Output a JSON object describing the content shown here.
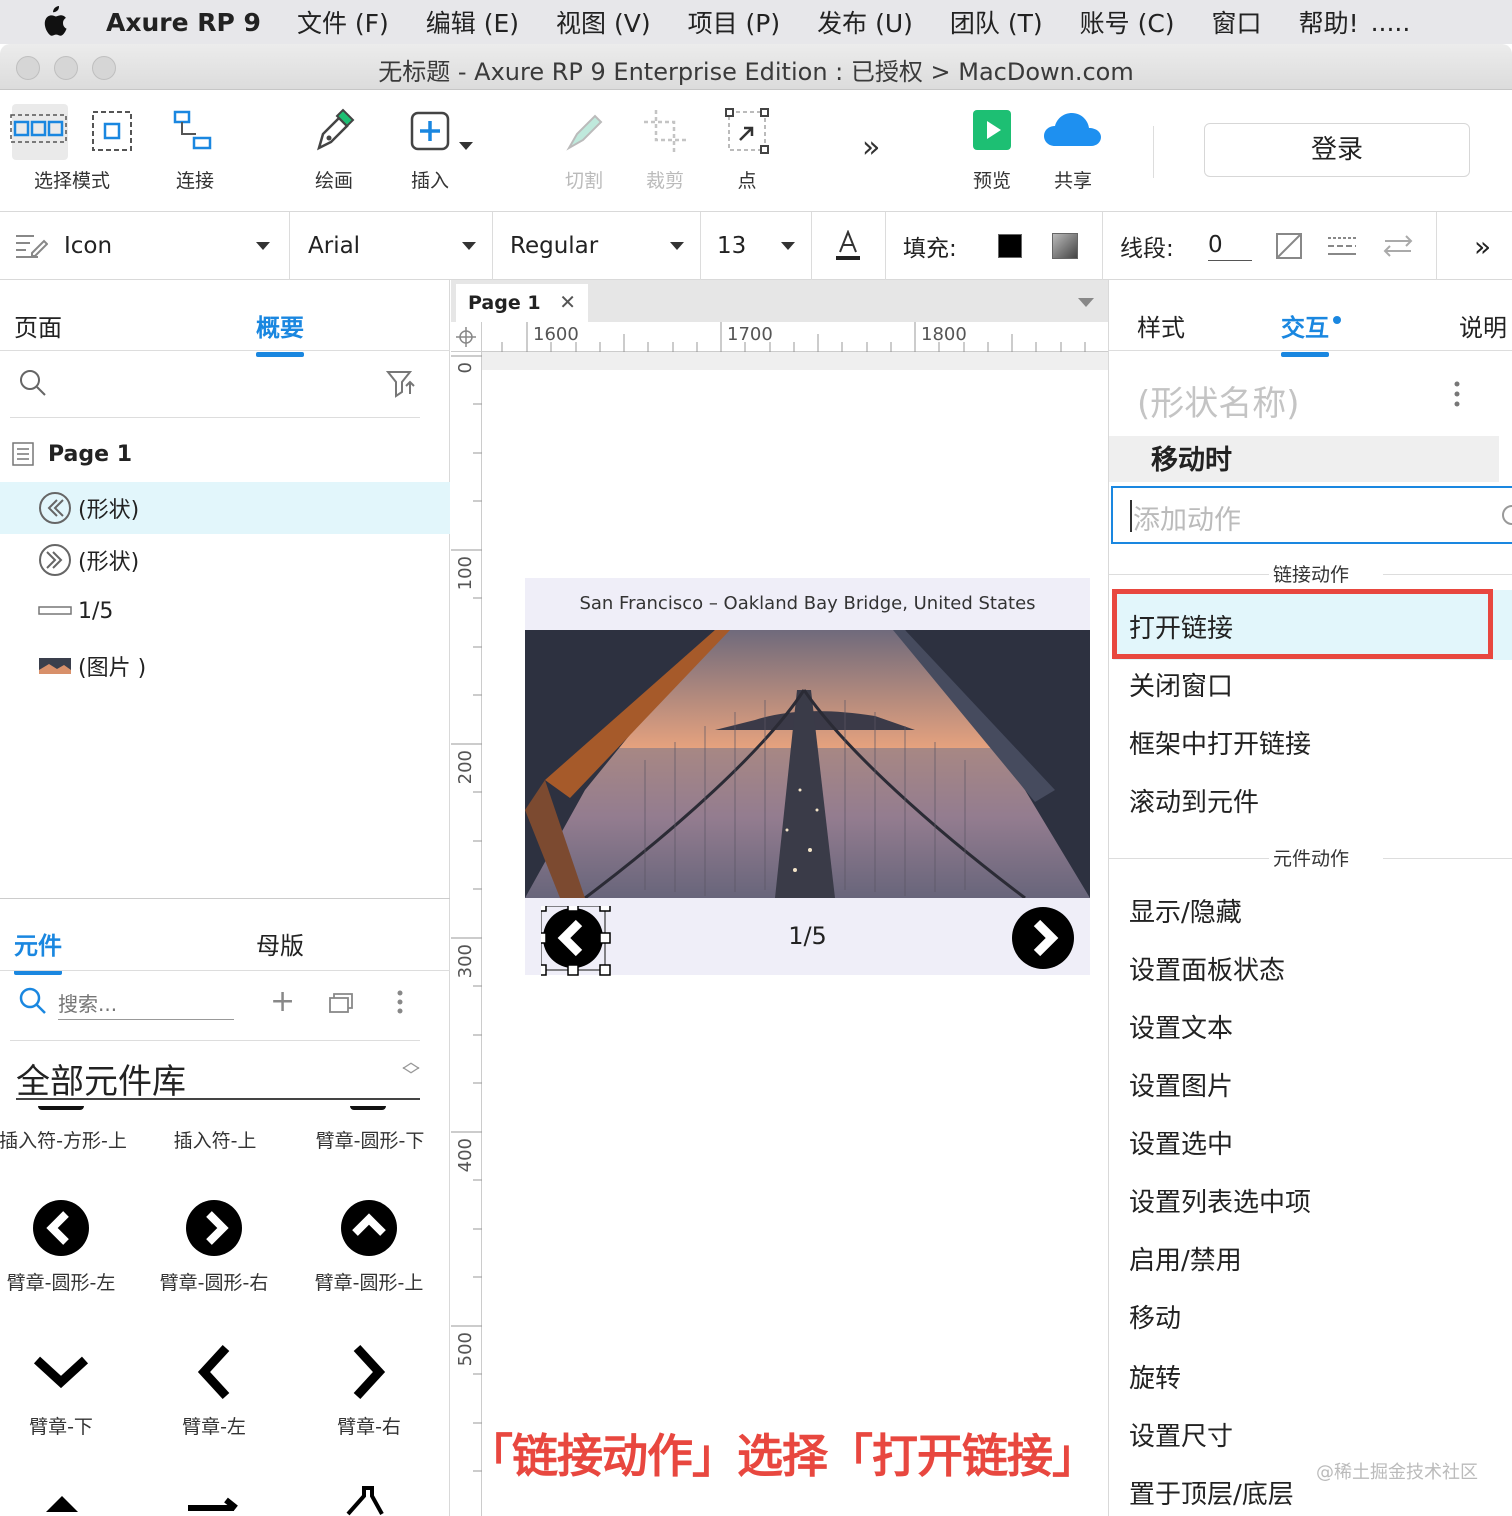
{
  "menubar": {
    "app_name": "Axure RP 9",
    "items": [
      "文件 (F)",
      "编辑 (E)",
      "视图 (V)",
      "项目 (P)",
      "发布 (U)",
      "团队 (T)",
      "账号 (C)",
      "窗口",
      "帮助!",
      "....."
    ]
  },
  "window": {
    "title": "无标题 - Axure RP 9 Enterprise Edition : 已授权 > MacDown.com"
  },
  "toolbar": {
    "select_mode": "选择模式",
    "connect": "连接",
    "draw": "绘画",
    "insert": "插入",
    "cut": "切割",
    "crop": "裁剪",
    "point": "点",
    "preview": "预览",
    "share": "共享",
    "login": "登录",
    "more": "»"
  },
  "format": {
    "style_name": "Icon",
    "font": "Arial",
    "weight": "Regular",
    "size": "13",
    "fill_label": "填充:",
    "line_label": "线段:",
    "line_value": "0"
  },
  "left": {
    "tab_pages": "页面",
    "tab_outline": "概要",
    "page_title": "Page 1",
    "outline_items": [
      "(形状)",
      "(形状)",
      "1/5",
      "(图片 )"
    ],
    "lib_tab_widgets": "元件",
    "lib_tab_masters": "母版",
    "lib_search_placeholder": "搜索...",
    "lib_dropdown": "全部元件库",
    "lib_row1": [
      "插入符-方形-上",
      "插入符-上",
      "臂章-圆形-下"
    ],
    "lib_row2": [
      "臂章-圆形-左",
      "臂章-圆形-右",
      "臂章-圆形-上"
    ],
    "lib_row3": [
      "臂章-下",
      "臂章-左",
      "臂章-右"
    ]
  },
  "canvas": {
    "page_tab": "Page 1",
    "ruler_h": [
      "1600",
      "1700",
      "1800"
    ],
    "ruler_v": [
      "0",
      "100",
      "200",
      "300",
      "400",
      "500"
    ],
    "slider_caption": "San Francisco – Oakland Bay Bridge, United States",
    "slider_counter": "1/5"
  },
  "right": {
    "tab_style": "样式",
    "tab_interact": "交互",
    "tab_notes": "说明",
    "shape_name_placeholder": "(形状名称)",
    "event": "移动时",
    "add_action_placeholder": "添加动作",
    "section_link": "链接动作",
    "link_actions": [
      "打开链接",
      "关闭窗口",
      "框架中打开链接",
      "滚动到元件"
    ],
    "section_widget": "元件动作",
    "widget_actions": [
      "显示/隐藏",
      "设置面板状态",
      "设置文本",
      "设置图片",
      "设置选中",
      "设置列表选中项",
      "启用/禁用",
      "移动",
      "旋转",
      "设置尺寸",
      "置于顶层/底层"
    ]
  },
  "caption": "「链接动作」选择「打开链接」",
  "watermark": "@稀土掘金技术社区",
  "colors": {
    "accent": "#1a87e0",
    "highlight": "#e8473f",
    "preview_green": "#1dbf73",
    "selection": "#e2f6fb"
  }
}
